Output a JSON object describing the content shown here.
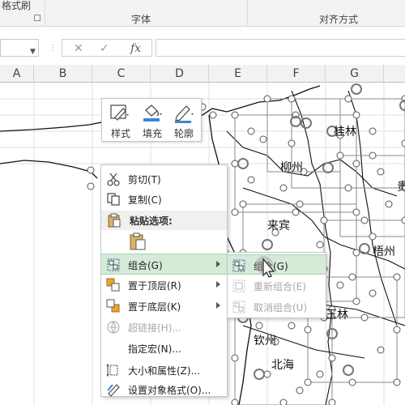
{
  "ribbon": {
    "format_painter": "格式刷",
    "font_group": "字体",
    "align_group": "对齐方式"
  },
  "formula_bar": {
    "cancel_symbol": "✕",
    "confirm_symbol": "✓",
    "fx_symbol": "fx",
    "value": ""
  },
  "columns": [
    "A",
    "B",
    "C",
    "D",
    "E",
    "F",
    "G"
  ],
  "map": {
    "cities": [
      "桂林",
      "柳州",
      "来宾",
      "梧州",
      "玉林",
      "钦州",
      "北海",
      "贵"
    ]
  },
  "mini_toolbar": {
    "style_label": "样式",
    "fill_label": "填充",
    "outline_label": "轮廓"
  },
  "context_menu": {
    "cut": "剪切(T)",
    "copy": "复制(C)",
    "paste_options": "粘贴选项:",
    "group": "组合(G)",
    "bring_to_front": "置于顶层(R)",
    "send_to_back": "置于底层(K)",
    "hyperlink": "超链接(H)...",
    "assign_macro": "指定宏(N)...",
    "size_properties": "大小和属性(Z)...",
    "format_object": "设置对象格式(O)..."
  },
  "sub_menu": {
    "group": "组合(G)",
    "regroup": "重新组合(E)",
    "ungroup": "取消组合(U)"
  },
  "colors": {
    "menu_highlight": "#d6ead8",
    "menu_highlight_border": "#a8d4ad",
    "disabled_text": "#a8a8a8"
  }
}
